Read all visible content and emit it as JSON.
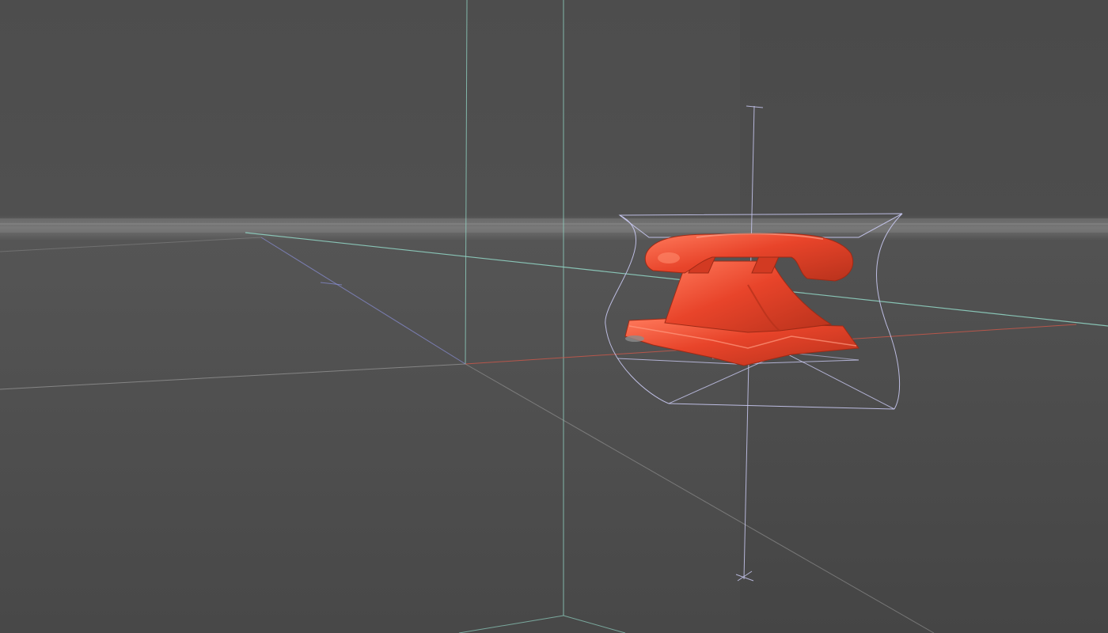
{
  "app": {
    "view_mode": "perspective"
  },
  "scene": {
    "background_color": "#4a4a4a",
    "horizon_color": "#7e7e7e",
    "object": {
      "name": "telephone",
      "icon": "telephone-icon",
      "color": "#e8442a",
      "shade_color": "#b8321c",
      "highlight_color": "#ff7a5c"
    },
    "guides": {
      "room_edge_color": "#8fd1c1",
      "axis_x_color": "#d0584a",
      "axis_y_color": "#8a8fd8",
      "axis_z_color": "#8fd1c1",
      "gizmo_color": "#c9c9f2"
    }
  }
}
